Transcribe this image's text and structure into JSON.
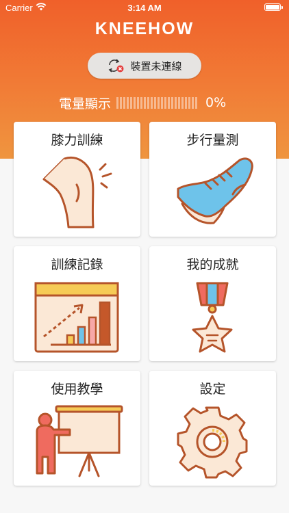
{
  "status_bar": {
    "carrier": "Carrier",
    "time": "3:14 AM",
    "wifi_icon": "wifi-icon",
    "battery_icon": "battery-icon"
  },
  "app": {
    "logo_text": "KNEEHOW"
  },
  "connection": {
    "label": "裝置未連線",
    "icon": "sync-disconnected-icon"
  },
  "battery": {
    "label": "電量顯示",
    "value": "0%",
    "level": 0
  },
  "menu": [
    {
      "label": "膝力訓練",
      "icon": "knee-icon"
    },
    {
      "label": "步行量測",
      "icon": "shoe-icon"
    },
    {
      "label": "訓練記錄",
      "icon": "bar-chart-icon"
    },
    {
      "label": "我的成就",
      "icon": "medal-icon"
    },
    {
      "label": "使用教學",
      "icon": "presentation-icon"
    },
    {
      "label": "設定",
      "icon": "gear-icon"
    }
  ],
  "colors": {
    "header_top": "#f0602a",
    "header_bottom": "#ef953f",
    "icon_outline": "#b5542a",
    "accent_blue": "#6ec3ea",
    "accent_red": "#ef6b5f",
    "accent_yellow": "#f6cb56",
    "cream": "#fbe8d6"
  }
}
